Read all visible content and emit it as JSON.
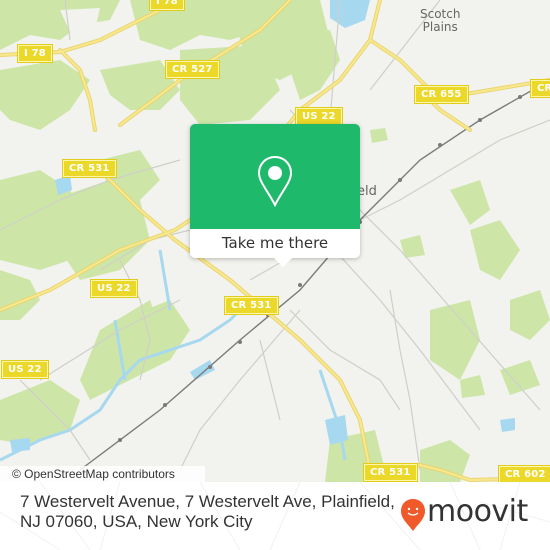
{
  "map": {
    "attribution": "© OpenStreetMap contributors",
    "colors": {
      "land": "#f2f2ee",
      "park": "#cde6a8",
      "water": "#a6d8ef",
      "road_major": "#f3e07a",
      "road_minor": "#d0d0cc",
      "rail": "#777777",
      "shield_bg": "#ecd829"
    },
    "place_labels": [
      {
        "name": "scotch-plains-label",
        "text": "Scotch\nPlains"
      },
      {
        "name": "plainfield-label",
        "text": "eld"
      }
    ],
    "road_shields": [
      {
        "name": "shield-i78-top",
        "text": "I 78"
      },
      {
        "name": "shield-i78-left",
        "text": "I 78"
      },
      {
        "name": "shield-cr527",
        "text": "CR 527"
      },
      {
        "name": "shield-us22-top",
        "text": "US 22"
      },
      {
        "name": "shield-cr655",
        "text": "CR 655"
      },
      {
        "name": "shield-cr-right",
        "text": "CR"
      },
      {
        "name": "shield-cr531-left",
        "text": "CR 531"
      },
      {
        "name": "shield-us22-mid",
        "text": "US 22"
      },
      {
        "name": "shield-cr531-center",
        "text": "CR 531"
      },
      {
        "name": "shield-us22-left",
        "text": "US 22"
      },
      {
        "name": "shield-cr531-bottom",
        "text": "CR 531"
      },
      {
        "name": "shield-cr602",
        "text": "CR 602"
      }
    ]
  },
  "popup": {
    "icon": "map-pin-icon",
    "button_label": "Take me there",
    "color": "#1fb96c"
  },
  "footer": {
    "address": "7 Westervelt Avenue, 7 Westervelt Ave, Plainfield, NJ 07060, USA, New York City",
    "logo_text": "moovit",
    "logo_color": "#f0592a"
  }
}
